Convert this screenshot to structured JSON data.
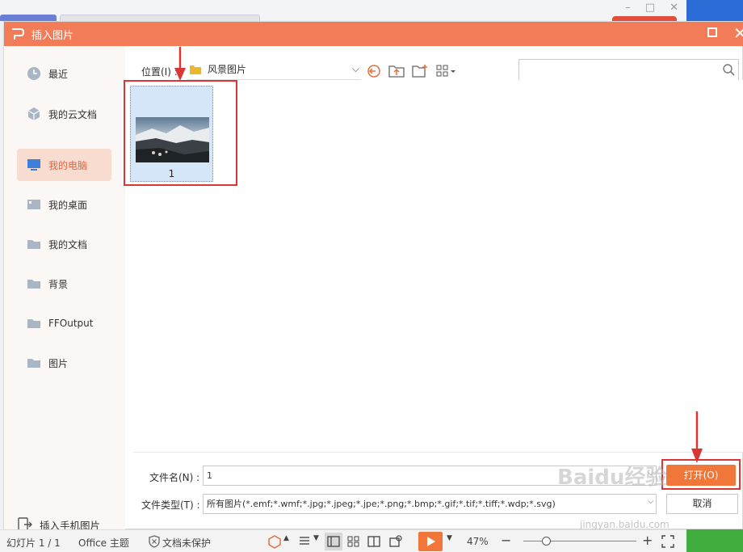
{
  "dialog": {
    "title": "插入图片"
  },
  "sidebar": {
    "items": [
      {
        "label": "最近",
        "icon": "clock-icon"
      },
      {
        "label": "我的云文档",
        "icon": "cube-icon"
      },
      {
        "label": "我的电脑",
        "icon": "monitor-icon",
        "active": true
      },
      {
        "label": "我的桌面",
        "icon": "desktop-icon"
      },
      {
        "label": "我的文档",
        "icon": "folder-icon"
      },
      {
        "label": "背景",
        "icon": "folder-icon"
      },
      {
        "label": "FFOutput",
        "icon": "folder-icon"
      },
      {
        "label": "图片",
        "icon": "folder-icon"
      }
    ],
    "phone_label": "插入手机图片"
  },
  "toolbar": {
    "location_label": "位置(I) :",
    "location_value": "风景图片"
  },
  "files": [
    {
      "name": "1"
    }
  ],
  "form": {
    "filename_label": "文件名(N) :",
    "filename_value": "1",
    "filetype_label": "文件类型(T) :",
    "filetype_value": "所有图片(*.emf;*.wmf;*.jpg;*.jpeg;*.jpe;*.png;*.bmp;*.gif;*.tif;*.tiff;*.wdp;*.svg)",
    "open_label": "打开(O)",
    "cancel_label": "取消"
  },
  "watermark": {
    "main": "Baidu经验",
    "sub": "jingyan.baidu.com"
  },
  "statusbar": {
    "slide": "幻灯片 1 / 1",
    "theme": "Office 主题",
    "protect": "文档未保护",
    "zoom": "47%",
    "zoom_fraction": 0.2
  },
  "colors": {
    "accent": "#f27b58",
    "open_button": "#f0763a",
    "highlight": "#d93636"
  }
}
